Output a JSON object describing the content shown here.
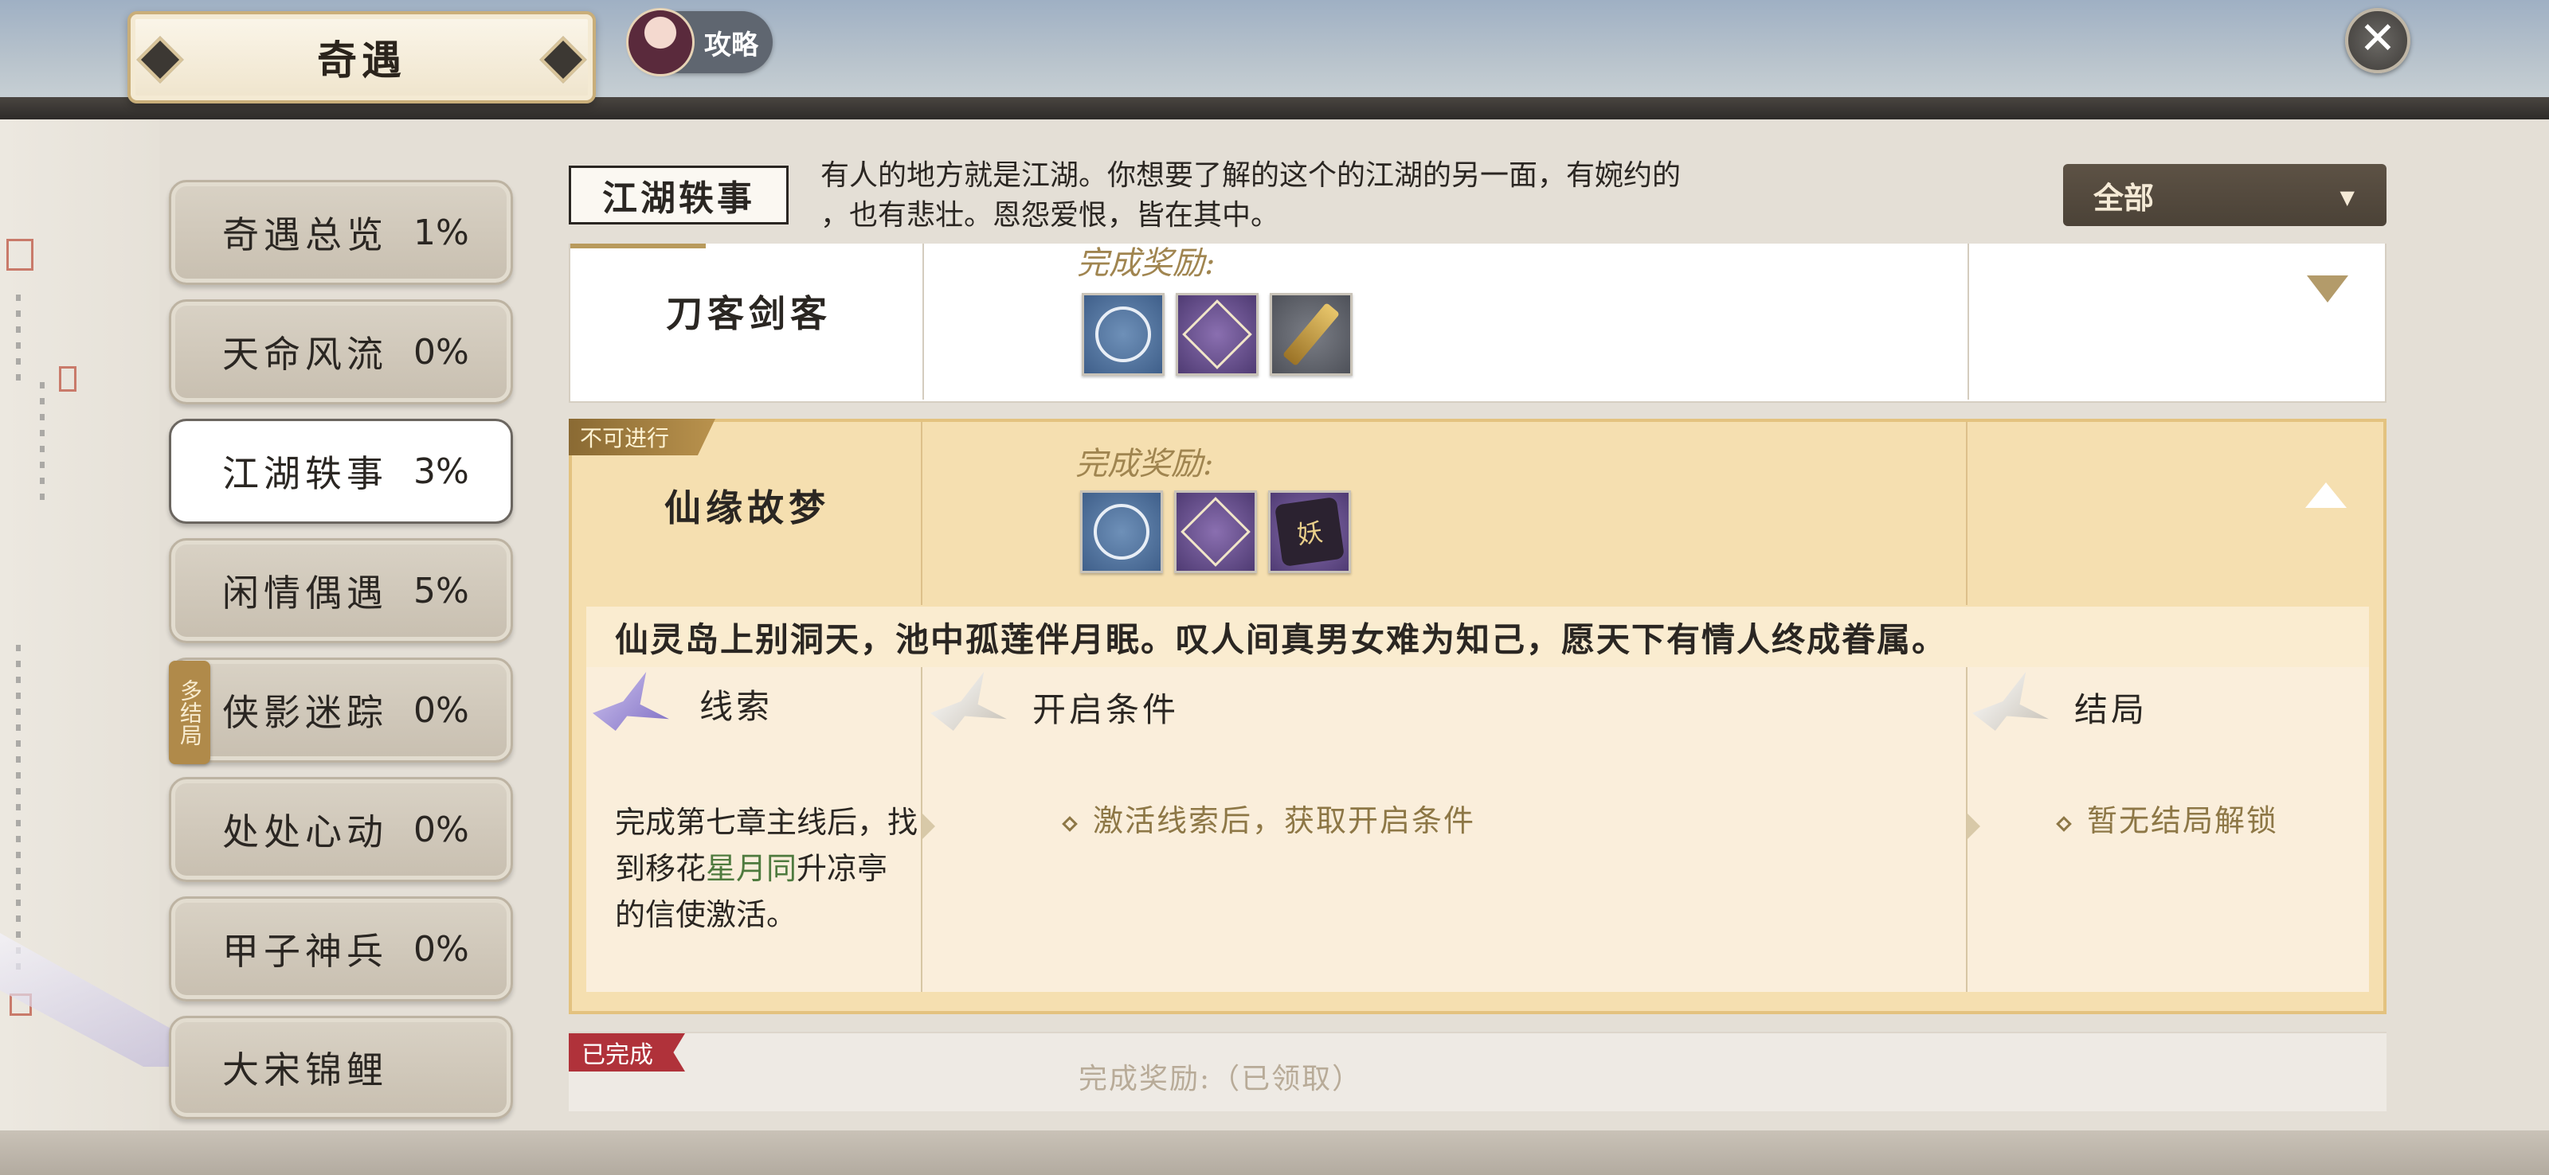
{
  "header": {
    "title": "奇遇",
    "guide_label": "攻略",
    "close_symbol": "✕"
  },
  "sidebar": {
    "items": [
      {
        "name": "奇遇总览",
        "pct": "1%"
      },
      {
        "name": "天命风流",
        "pct": "0%"
      },
      {
        "name": "江湖轶事",
        "pct": "3%",
        "active": true
      },
      {
        "name": "闲情偶遇",
        "pct": "5%"
      },
      {
        "name": "侠影迷踪",
        "pct": "0%"
      },
      {
        "name": "处处心动",
        "pct": "0%"
      },
      {
        "name": "甲子神兵",
        "pct": "0%"
      },
      {
        "name": "大宋锦鲤",
        "pct": ""
      }
    ],
    "multi_tag": "多结局"
  },
  "category": {
    "label": "江湖轶事",
    "desc_line1": "有人的地方就是江湖。你想要了解的这个的江湖的另一面，有婉约的",
    "desc_line2": "，也有悲壮。恩怨爱恨，皆在其中。"
  },
  "filter": {
    "selected": "全部"
  },
  "quests": {
    "first": {
      "name": "刀客剑客",
      "reward_label": "完成奖励:",
      "rewards": [
        "blue-orb-icon",
        "purple-token-icon",
        "gold-scroll-icon"
      ]
    },
    "second": {
      "locked_tag": "不可进行",
      "name": "仙缘故梦",
      "reward_label": "完成奖励:",
      "rewards": [
        "blue-orb-icon",
        "purple-token-icon",
        "purple-token-icon"
      ],
      "reward3_char": "妖",
      "poem": "仙灵岛上别洞天，池中孤莲伴月眠。叹人间真男女难为知己，愿天下有情人终成眷属。",
      "clue_head": "线索",
      "clue_text_a": "完成第七章主线后，找到移花",
      "clue_text_b": "星月同",
      "clue_text_c": "升凉亭的信使激活",
      "clue_text_d": "。",
      "cond_head": "开启条件",
      "cond_item": "激活线索后，获取开启条件",
      "ending_head": "结局",
      "ending_item": "暂无结局解锁"
    },
    "third": {
      "done_tag": "已完成",
      "reward_label": "完成奖励:（已领取）"
    }
  },
  "colors": {
    "accent_gold": "#e3c27f",
    "done_red": "#b0323a",
    "filter_bg": "#4b4237"
  }
}
